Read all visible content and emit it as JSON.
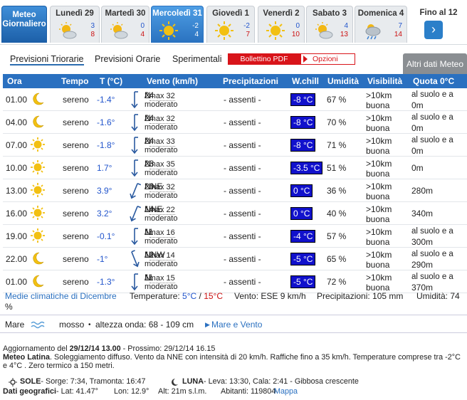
{
  "tabs_days": [
    {
      "name": "Meteo Giornaliero"
    },
    {
      "name": "Lunedì 29",
      "min": "3",
      "max": "8",
      "icon": "sun-cloud-icon"
    },
    {
      "name": "Martedì 30",
      "min": "0",
      "max": "4",
      "icon": "sun-cloud-icon"
    },
    {
      "name": "Mercoledì 31",
      "min": "-2",
      "max": "4",
      "icon": "sun-icon"
    },
    {
      "name": "Giovedì 1",
      "min": "-2",
      "max": "7",
      "icon": "sun-icon"
    },
    {
      "name": "Venerdì 2",
      "min": "0",
      "max": "10",
      "icon": "sun-icon"
    },
    {
      "name": "Sabato 3",
      "min": "4",
      "max": "13",
      "icon": "sun-cloud-icon"
    },
    {
      "name": "Domenica 4",
      "min": "7",
      "max": "14",
      "icon": "rain-icon"
    }
  ],
  "more_label": "Fino al 12",
  "subtabs": {
    "triorarie": "Previsioni Triorarie",
    "orarie": "Previsioni Orarie",
    "sperimentali": "Sperimentali",
    "pdf": "Bollettino PDF",
    "opzioni": "Opzioni",
    "altri": "Altri dati Meteo"
  },
  "headers": {
    "ora": "Ora",
    "tempo": "Tempo",
    "t": "T (°C)",
    "vento": "Vento (km/h)",
    "prec": "Precipitazioni",
    "wchill": "W.chill",
    "umid": "Umidità",
    "vis": "Visibilità",
    "quota": "Quota 0°C"
  },
  "rows": [
    {
      "ora": "01.00",
      "icon": "moon-icon",
      "tempo": "sereno",
      "t": "-1.4°",
      "vdir": "N",
      "vspd": "24",
      "vmax": "max 32",
      "vdesc": "moderato",
      "prec": "- assenti -",
      "wc": "-8 °C",
      "um": "67 %",
      "vis1": ">10km",
      "vis2": "buona",
      "q1": "al suolo e a",
      "q2": "0m"
    },
    {
      "ora": "04.00",
      "icon": "moon-icon",
      "tempo": "sereno",
      "t": "-1.6°",
      "vdir": "N",
      "vspd": "24",
      "vmax": "max 32",
      "vdesc": "moderato",
      "prec": "- assenti -",
      "wc": "-8 °C",
      "um": "70 %",
      "vis1": ">10km",
      "vis2": "buona",
      "q1": "al suolo e a",
      "q2": "0m"
    },
    {
      "ora": "07.00",
      "icon": "sun-icon",
      "tempo": "sereno",
      "t": "-1.8°",
      "vdir": "N",
      "vspd": "24",
      "vmax": "max 33",
      "vdesc": "moderato",
      "prec": "- assenti -",
      "wc": "-8 °C",
      "um": "71 %",
      "vis1": ">10km",
      "vis2": "buona",
      "q1": "al suolo e a",
      "q2": "0m"
    },
    {
      "ora": "10.00",
      "icon": "sun-icon",
      "tempo": "sereno",
      "t": "1.7°",
      "vdir": "N",
      "vspd": "23",
      "vmax": "max 35",
      "vdesc": "moderato",
      "prec": "- assenti -",
      "wc": "-3.5 °C",
      "um": "51 %",
      "vis1": ">10km",
      "vis2": "buona",
      "q1": "",
      "q2": "",
      "qs": "0m"
    },
    {
      "ora": "13.00",
      "icon": "sun-icon",
      "tempo": "sereno",
      "t": "3.9°",
      "vdir": "NNE",
      "vspd": "20",
      "vmax": "max 32",
      "vdesc": "moderato",
      "prec": "- assenti -",
      "wc": "0 °C",
      "um": "36 %",
      "vis1": ">10km",
      "vis2": "buona",
      "q1": "",
      "q2": "",
      "qs": "280m"
    },
    {
      "ora": "16.00",
      "icon": "sun-icon",
      "tempo": "sereno",
      "t": "3.2°",
      "vdir": "NNE",
      "vspd": "14",
      "vmax": "max 22",
      "vdesc": "moderato",
      "prec": "- assenti -",
      "wc": "0 °C",
      "um": "40 %",
      "vis1": ">10km",
      "vis2": "buona",
      "q1": "",
      "q2": "",
      "qs": "340m"
    },
    {
      "ora": "19.00",
      "icon": "sun-icon",
      "tempo": "sereno",
      "t": "-0.1°",
      "vdir": "N",
      "vspd": "11",
      "vmax": "max 16",
      "vdesc": "moderato",
      "prec": "- assenti -",
      "wc": "-4 °C",
      "um": "57 %",
      "vis1": ">10km",
      "vis2": "buona",
      "q1": "al suolo e a",
      "q2": "300m"
    },
    {
      "ora": "22.00",
      "icon": "moon-icon",
      "tempo": "sereno",
      "t": "-1°",
      "vdir": "NNW",
      "vspd": "12",
      "vmax": "max 14",
      "vdesc": "moderato",
      "prec": "- assenti -",
      "wc": "-5 °C",
      "um": "65 %",
      "vis1": ">10km",
      "vis2": "buona",
      "q1": "al suolo e a",
      "q2": "290m"
    },
    {
      "ora": "01.00",
      "icon": "moon-icon",
      "tempo": "sereno",
      "t": "-1.3°",
      "vdir": "N",
      "vspd": "11",
      "vmax": "max 15",
      "vdesc": "moderato",
      "prec": "- assenti -",
      "wc": "-5 °C",
      "um": "72 %",
      "vis1": ">10km",
      "vis2": "buona",
      "q1": "al suolo e a",
      "q2": "370m"
    }
  ],
  "medie": {
    "link": "Medie climatiche di Dicembre",
    "temp_label": "Temperature:",
    "tmin": "5°C",
    "sep": " / ",
    "tmax": "15°C",
    "vento": "Vento: ESE 9 km/h",
    "prec": "Precipitazioni: 105 mm",
    "umid": "Umidità: 74",
    "pct": "%"
  },
  "mare": {
    "label": "Mare",
    "stato": "mosso",
    "onda": "altezza onda: 68 - 109 cm",
    "link": "Mare e Vento"
  },
  "footer": {
    "agg_label": "Aggiornamento del ",
    "agg_date": "29/12/14 13.00",
    "prossimo": " - Prossimo: 29/12/14 16.15",
    "ml_title": "Meteo Latina",
    "ml_text": ". Soleggiamento diffuso. Vento da NNE con intensità di 20 km/h. Raffiche fino a 35 km/h. Temperature comprese tra -2°C e 4°C . Zero termico a 150 metri.",
    "sole_label": "SOLE",
    "sole_text": " - Sorge: 7:34, Tramonta: 16:47",
    "luna_label": "LUNA",
    "luna_text": " - Leva: 13:30, Cala: 2:41 - Gibbosa crescente",
    "geo_label": "Dati geografici",
    "lat": " - Lat: 41.47°",
    "lon": "Lon: 12.9°",
    "alt": "Alt: 21m s.l.m.",
    "abit": "Abitanti: 119804",
    "mappa": "Mappa"
  },
  "colors": {
    "header": "#2a70c0",
    "windchill": "#1111cc",
    "pdf": "#d8141a"
  }
}
